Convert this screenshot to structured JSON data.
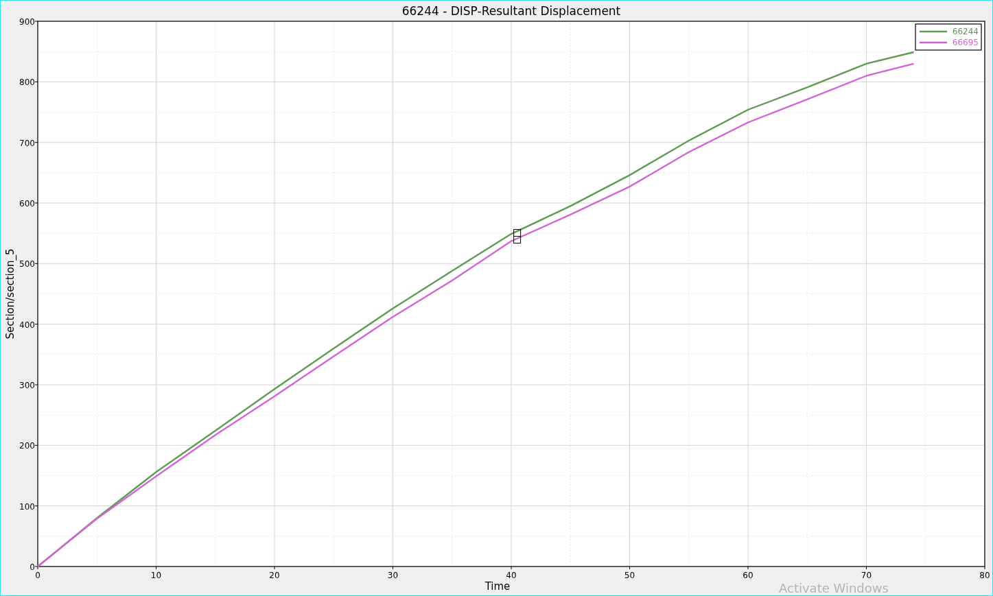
{
  "chart_panel": {
    "chart_data": {
      "type": "line",
      "title": "66244 - DISP-Resultant Displacement",
      "xlabel": "Time",
      "ylabel": "Section/section_5",
      "x": [
        0,
        5,
        10,
        15,
        20,
        25,
        30,
        35,
        40,
        45,
        50,
        55,
        60,
        65,
        70,
        74
      ],
      "series": [
        {
          "name": "66244",
          "color": "#5f9a55",
          "values": [
            0,
            80,
            156,
            224,
            293,
            360,
            426,
            488,
            549,
            595,
            646,
            703,
            754,
            791,
            830,
            849
          ]
        },
        {
          "name": "66695",
          "color": "#d264d6",
          "values": [
            0,
            79,
            149,
            217,
            281,
            347,
            412,
            472,
            537,
            581,
            627,
            684,
            733,
            771,
            810,
            830
          ]
        }
      ],
      "xlim": [
        0,
        80
      ],
      "ylim": [
        0,
        900
      ],
      "xticks": [
        0,
        10,
        20,
        30,
        40,
        50,
        60,
        70,
        80
      ],
      "yticks": [
        0,
        100,
        200,
        300,
        400,
        500,
        600,
        700,
        800,
        900
      ],
      "grid": true,
      "legend": true
    }
  },
  "os_notice": "Activate Windows"
}
